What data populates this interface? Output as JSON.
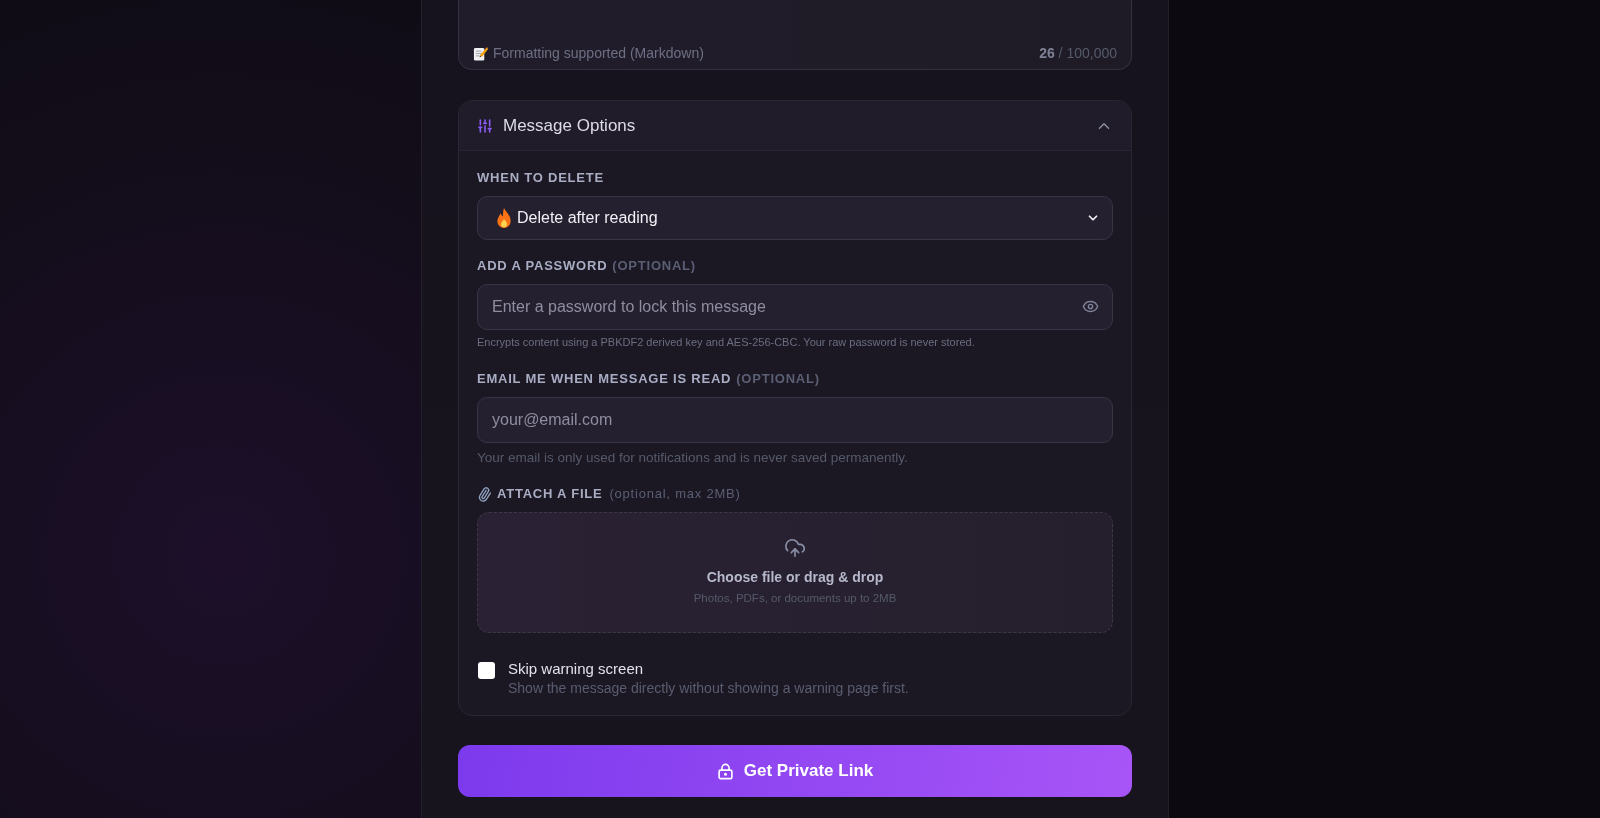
{
  "editor": {
    "format_note": "Formatting supported (Markdown)",
    "counter": "**26** / 100,000"
  },
  "options": {
    "title": "Message Options",
    "expanded": true,
    "fields": [
      {
        "kind": "select",
        "label": "WHEN TO DELETE",
        "value": "Delete after reading"
      },
      {
        "kind": "password",
        "label": "ADD A PASSWORD",
        "optional": "(OPTIONAL)",
        "placeholder": "Enter a password to lock this message",
        "help": "Encrypts content using a PBKDF2 derived key and AES-256-CBC. Your raw password is never stored."
      },
      {
        "kind": "email",
        "label": "EMAIL ME WHEN MESSAGE IS READ",
        "optional": "(OPTIONAL)",
        "placeholder": "your@email.com",
        "help": "Your email is only used for notifications and is never saved permanently."
      },
      {
        "kind": "file",
        "label": "ATTACH A FILE",
        "optional": "(optional, max 2MB)",
        "title": "Choose file or drag & drop",
        "hint": "Photos, PDFs, or documents up to 2MB"
      },
      {
        "kind": "checkbox",
        "label": "Skip warning screen",
        "description": "Show the message directly without showing a warning page first.",
        "checked": false
      }
    ]
  },
  "submit": {
    "label": "Get Private Link"
  }
}
